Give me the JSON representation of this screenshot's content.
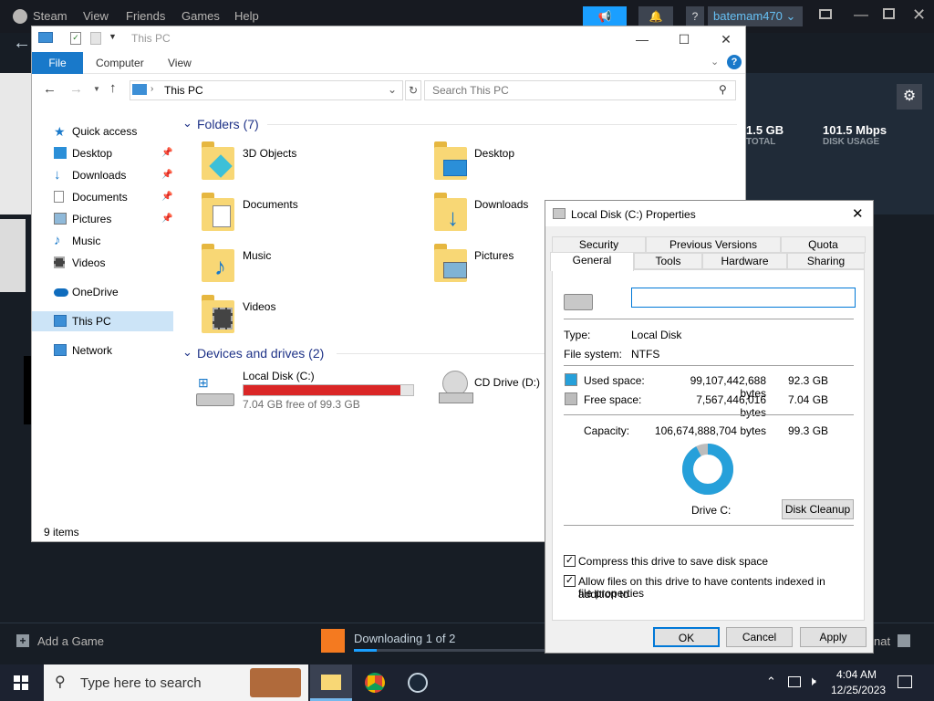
{
  "steam": {
    "menu": [
      "Steam",
      "View",
      "Friends",
      "Games",
      "Help"
    ],
    "user": "batemam470",
    "stat1_value": "1.5 GB",
    "stat1_label": "TOTAL",
    "stat2_value": "101.5 Mbps",
    "stat2_label": "DISK USAGE",
    "add_game": "Add a Game",
    "downloading": "Downloading 1 of 2",
    "chat": "nat"
  },
  "explorer": {
    "title": "This PC",
    "tabs": {
      "file": "File",
      "computer": "Computer",
      "view": "View"
    },
    "address": "This PC",
    "search_placeholder": "Search This PC",
    "nav": {
      "quick_access": "Quick access",
      "desktop": "Desktop",
      "downloads": "Downloads",
      "documents": "Documents",
      "pictures": "Pictures",
      "music": "Music",
      "videos": "Videos",
      "onedrive": "OneDrive",
      "thispc": "This PC",
      "network": "Network"
    },
    "folders_header": "Folders (7)",
    "folders": {
      "objects3d": "3D Objects",
      "desktop": "Desktop",
      "documents": "Documents",
      "downloads": "Downloads",
      "music": "Music",
      "pictures": "Pictures",
      "videos": "Videos"
    },
    "drives_header": "Devices and drives (2)",
    "drive_c": {
      "name": "Local Disk (C:)",
      "free": "7.04 GB free of 99.3 GB",
      "used_fraction": 0.923
    },
    "drive_d": {
      "name": "CD Drive (D:)"
    },
    "status": "9 items"
  },
  "props": {
    "title": "Local Disk (C:) Properties",
    "tabs": {
      "security": "Security",
      "previous": "Previous Versions",
      "quota": "Quota",
      "general": "General",
      "tools": "Tools",
      "hardware": "Hardware",
      "sharing": "Sharing"
    },
    "type_label": "Type:",
    "type_value": "Local Disk",
    "fs_label": "File system:",
    "fs_value": "NTFS",
    "used_label": "Used space:",
    "used_bytes": "99,107,442,688 bytes",
    "used_gb": "92.3 GB",
    "free_label": "Free space:",
    "free_bytes": "7,567,446,016 bytes",
    "free_gb": "7.04 GB",
    "cap_label": "Capacity:",
    "cap_bytes": "106,674,888,704 bytes",
    "cap_gb": "99.3 GB",
    "drive_label": "Drive C:",
    "cleanup": "Disk Cleanup",
    "compress": "Compress this drive to save disk space",
    "index_line1": "Allow files on this drive to have contents indexed in addition to",
    "index_line2": "file properties",
    "ok": "OK",
    "cancel": "Cancel",
    "apply": "Apply",
    "used_color": "#26a0da",
    "free_color": "#bcbcbc"
  },
  "taskbar": {
    "search": "Type here to search",
    "time": "4:04 AM",
    "date": "12/25/2023"
  }
}
